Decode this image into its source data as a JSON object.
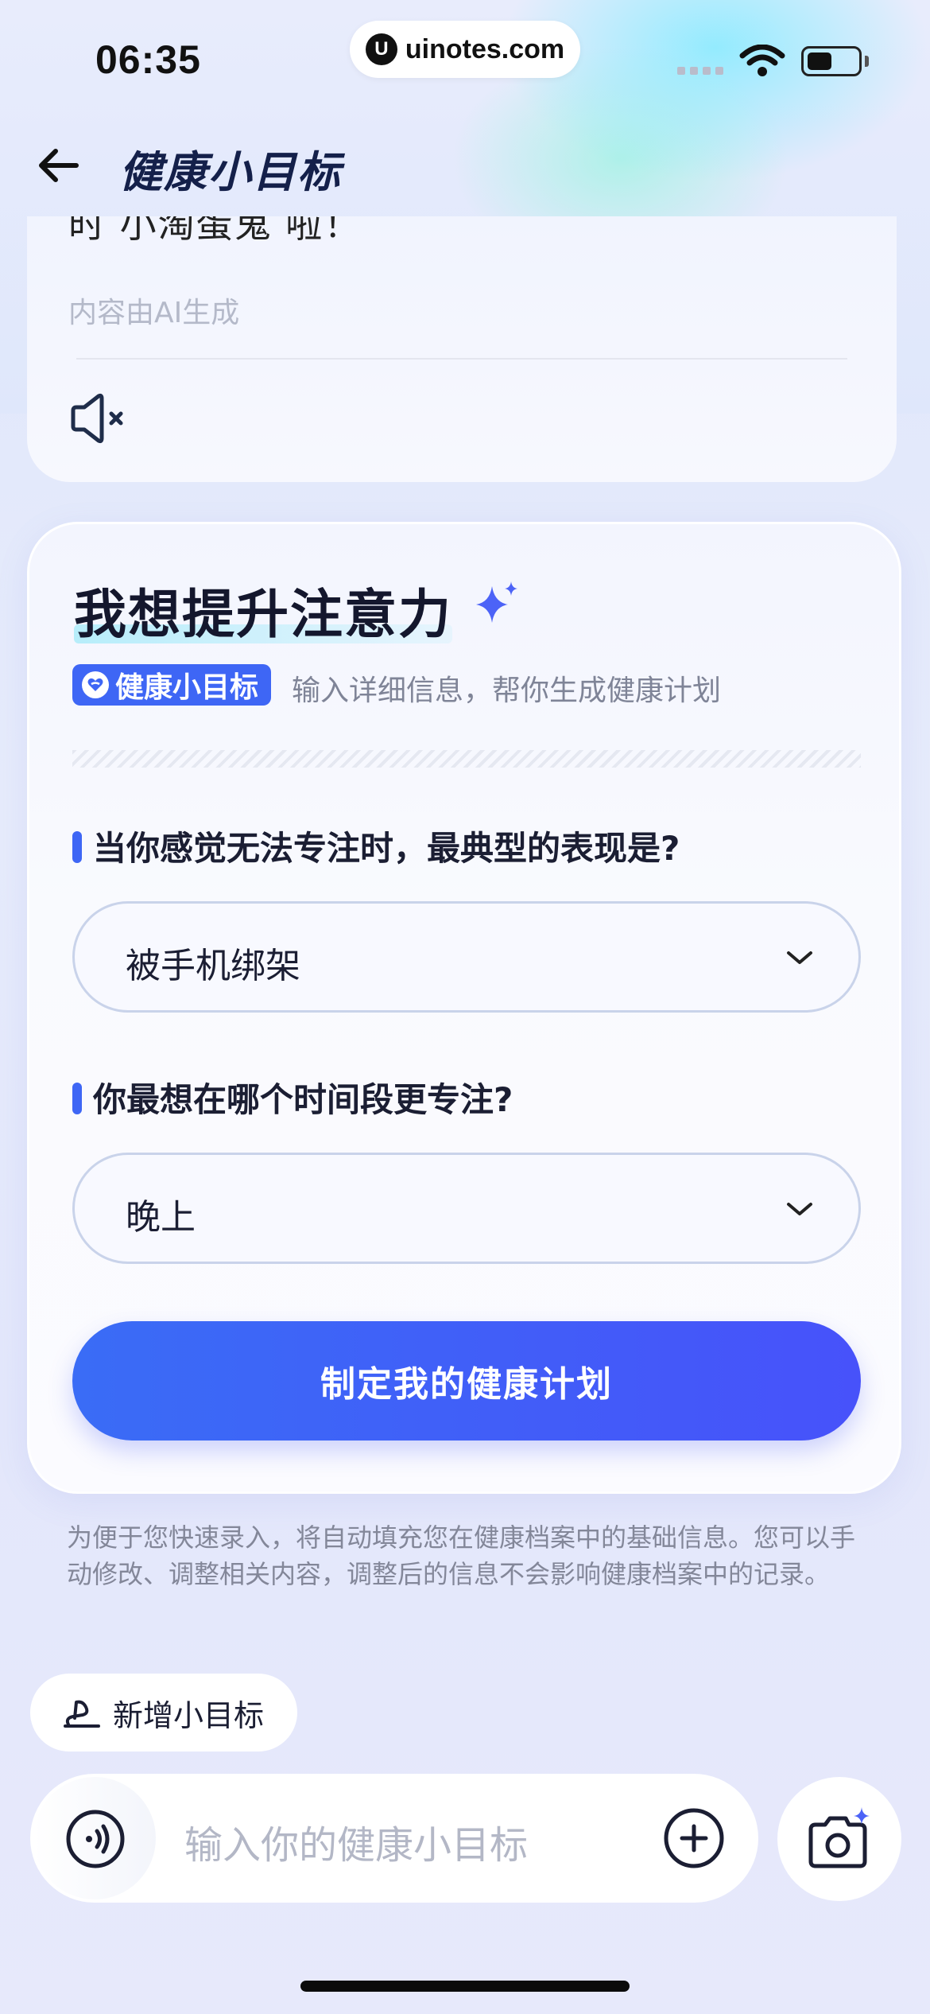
{
  "status_bar": {
    "time": "06:35",
    "url": "uinotes.com",
    "url_logo": "U"
  },
  "header": {
    "title": "健康小目标"
  },
  "ai_card": {
    "clipped_text": "时 小淘蛋鬼 啦！",
    "note": "内容由AI生成"
  },
  "goal_card": {
    "title": "我想提升注意力",
    "tag_label": "健康小目标",
    "tag_desc": "输入详细信息，帮你生成健康计划",
    "questions": [
      {
        "label": "当你感觉无法专注时，最典型的表现是?",
        "value": "被手机绑架"
      },
      {
        "label": "你最想在哪个时间段更专注?",
        "value": "晚上"
      }
    ],
    "cta_label": "制定我的健康计划"
  },
  "disclaimer": "为便于您快速录入，将自动填充您在健康档案中的基础信息。您可以手动修改、调整相关内容，调整后的信息不会影响健康档案中的记录。",
  "new_goal_label": "新增小目标",
  "input_bar": {
    "placeholder": "输入你的健康小目标"
  },
  "colors": {
    "accent": "#3e66f5",
    "cta_end": "#4752fa",
    "title_text": "#14204a"
  }
}
